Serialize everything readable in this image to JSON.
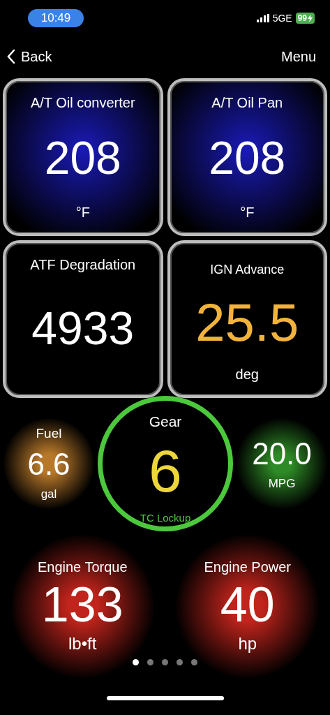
{
  "status_bar": {
    "time": "10:49",
    "network": "5GE",
    "battery": "99",
    "charging": true
  },
  "nav": {
    "back": "Back",
    "menu": "Menu"
  },
  "tiles": [
    {
      "kind": "blue",
      "title": "A/T Oil converter",
      "value": "208",
      "unit": "°F",
      "color": "#ffffff"
    },
    {
      "kind": "blue",
      "title": "A/T Oil Pan",
      "value": "208",
      "unit": "°F",
      "color": "#ffffff"
    },
    {
      "kind": "plain",
      "title": "ATF Degradation",
      "value": "4933",
      "color": "#ffffff"
    },
    {
      "kind": "plain",
      "title": "IGN Advance",
      "value": "25.5",
      "unit": "deg",
      "color": "#f2b33d"
    }
  ],
  "round_gauges": [
    {
      "kind": "glow",
      "title": "Fuel",
      "value": "6.6",
      "unit": "gal",
      "color": "#b8782a"
    },
    {
      "kind": "ring",
      "title": "Gear",
      "value": "6",
      "unit": "TC Lockup",
      "color": "#4cc83c"
    },
    {
      "kind": "glow",
      "value": "20.0",
      "unit": "MPG",
      "color": "#2e8a26"
    }
  ],
  "big_gauges": [
    {
      "title": "Engine Torque",
      "value": "133",
      "unit": "lb•ft",
      "color": "#c0241c"
    },
    {
      "title": "Engine Power",
      "value": "40",
      "unit": "hp",
      "color": "#c0241c"
    }
  ],
  "pages": [
    {
      "selected": true
    },
    {
      "selected": false
    },
    {
      "selected": false
    },
    {
      "selected": false
    },
    {
      "selected": false
    }
  ]
}
